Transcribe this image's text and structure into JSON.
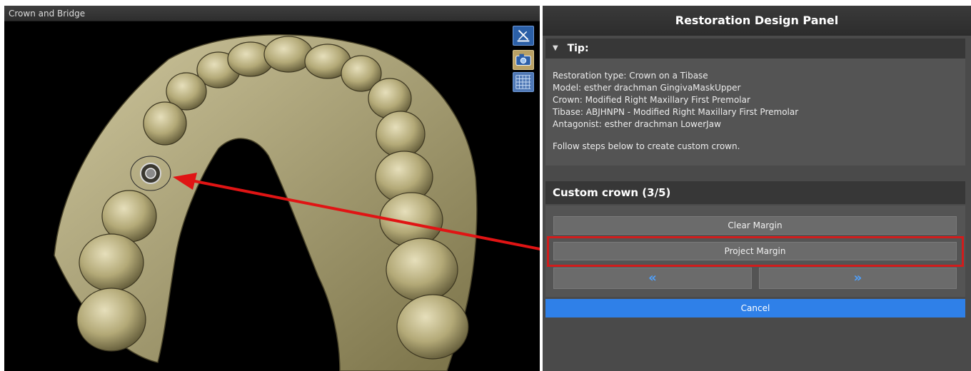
{
  "viewport": {
    "title": "Crown and Bridge",
    "tools": [
      {
        "icon": "measure-icon"
      },
      {
        "icon": "camera-icon"
      },
      {
        "icon": "grid-icon"
      }
    ]
  },
  "panel": {
    "title": "Restoration Design Panel",
    "tip": {
      "header": "Tip:",
      "lines": [
        "Restoration type: Crown on a Tibase",
        "Model: esther drachman GingivaMaskUpper",
        "Crown: Modified Right Maxillary First Premolar",
        "Tibase: ABJHNPN - Modified Right Maxillary First Premolar",
        "Antagonist: esther drachman LowerJaw"
      ],
      "follow": "Follow steps below to create custom crown."
    },
    "step": {
      "header": "Custom crown (3/5)",
      "clear_label": "Clear Margin",
      "project_label": "Project Margin",
      "prev_label": "«",
      "next_label": "»",
      "cancel_label": "Cancel"
    }
  },
  "colors": {
    "accent": "#2f80e8",
    "highlight": "#d11c1c",
    "panel_bg": "#4a4a4a",
    "model": "#bdb48c"
  }
}
